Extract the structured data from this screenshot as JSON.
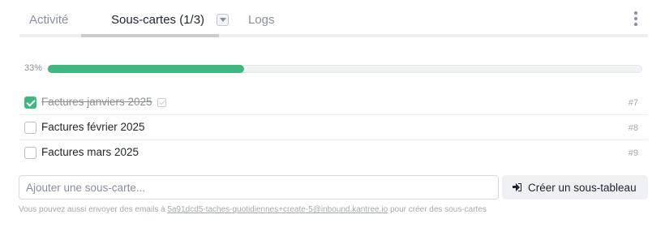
{
  "tabs": [
    {
      "label": "Activité",
      "active": false
    },
    {
      "label": "Sous-cartes (1/3)",
      "active": true
    },
    {
      "label": "Logs",
      "active": false
    }
  ],
  "progress": {
    "label": "33%",
    "fraction": 0.33,
    "color": "#3fb77f"
  },
  "subcards": [
    {
      "title": "Factures janviers 2025",
      "done": true,
      "number": "#7"
    },
    {
      "title": "Factures février 2025",
      "done": false,
      "number": "#8"
    },
    {
      "title": "Factures mars 2025",
      "done": false,
      "number": "#9"
    }
  ],
  "add": {
    "placeholder": "Ajouter une sous-carte...",
    "value": "",
    "create_button_label": "Créer un sous-tableau",
    "create_button_icon": "sign-in-icon"
  },
  "email_hint": {
    "prefix": "Vous pouvez aussi envoyer des emails à ",
    "address": "5a91dcd5-taches-quotidiennes+create-5@inbound.kantree.io",
    "suffix": " pour créer des sous-cartes"
  },
  "colors": {
    "accent": "#3fb77f",
    "muted_text": "#8a8f9c"
  },
  "icons": {
    "tab_dropdown": "caret-down-icon",
    "menu": "kebab-menu-icon",
    "done_marker": "checklist-icon"
  }
}
